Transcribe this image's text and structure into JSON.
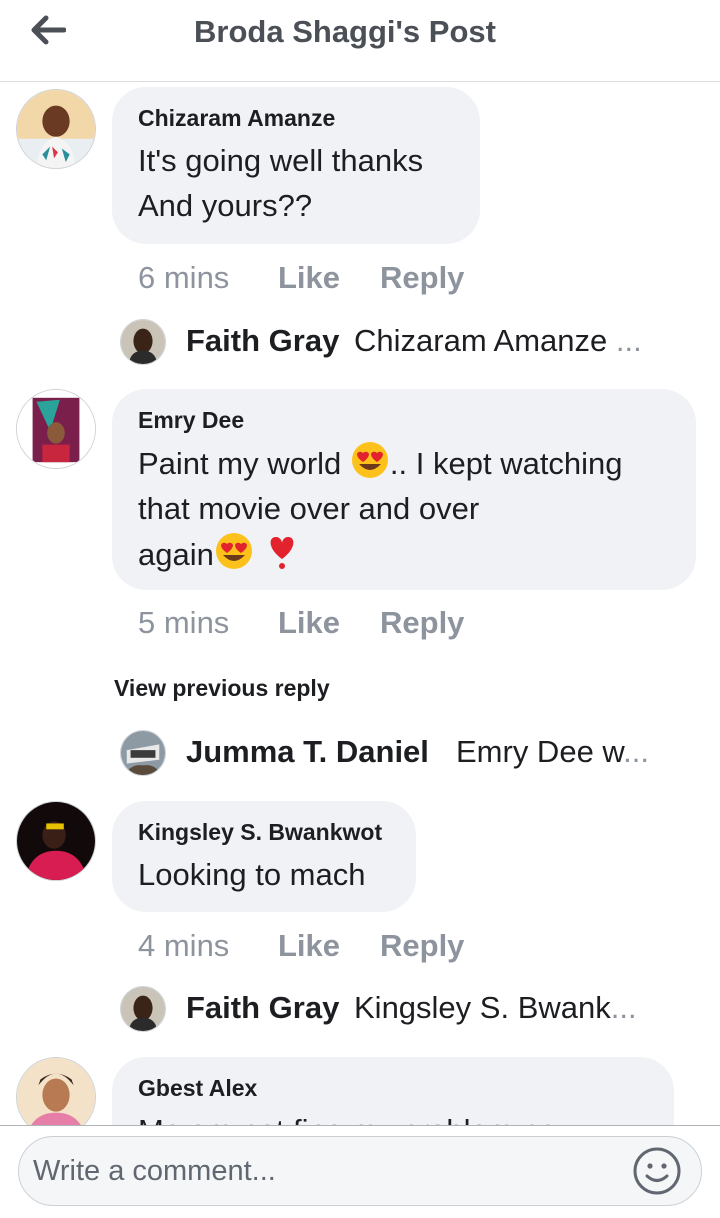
{
  "header": {
    "title": "Broda Shaggi's Post",
    "back_icon": "arrow-left-icon"
  },
  "comments": [
    {
      "author": "Chizaram Amanze",
      "text_lines": [
        "It's going well thanks",
        "And yours??"
      ],
      "time": "6 mins",
      "like": "Like",
      "reply": "Reply",
      "reply_preview": {
        "name": "Faith Gray",
        "snippet": "Chizaram Amanze",
        "ellipsis": "..."
      }
    },
    {
      "author": "Emry Dee",
      "text_lines": [
        "Paint my world",
        ".. I kept watching",
        "that movie over and over",
        "again"
      ],
      "emojis": [
        "heart-eyes-emoji",
        "red-heart-emoji"
      ],
      "time": "5 mins",
      "like": "Like",
      "reply": "Reply",
      "view_previous": "View previous reply",
      "reply_preview": {
        "name": "Jumma T. Daniel",
        "snippet": "Emry Dee w",
        "ellipsis": "..."
      }
    },
    {
      "author": "Kingsley S. Bwankwot",
      "text_lines": [
        "Looking to mach"
      ],
      "time": "4 mins",
      "like": "Like",
      "reply": "Reply",
      "reply_preview": {
        "name": "Faith Gray",
        "snippet": "Kingsley S. Bwank",
        "ellipsis": "..."
      }
    },
    {
      "author": "Gbest Alex",
      "text_lines": [
        "Me am not fine my problem na"
      ]
    }
  ],
  "composer": {
    "placeholder": "Write a comment...",
    "emoji_icon": "smiley-icon"
  },
  "colors": {
    "bubble": "#f0f2f5",
    "muted": "#8d949e",
    "title": "#4b4f56",
    "text": "#1c1e21"
  }
}
